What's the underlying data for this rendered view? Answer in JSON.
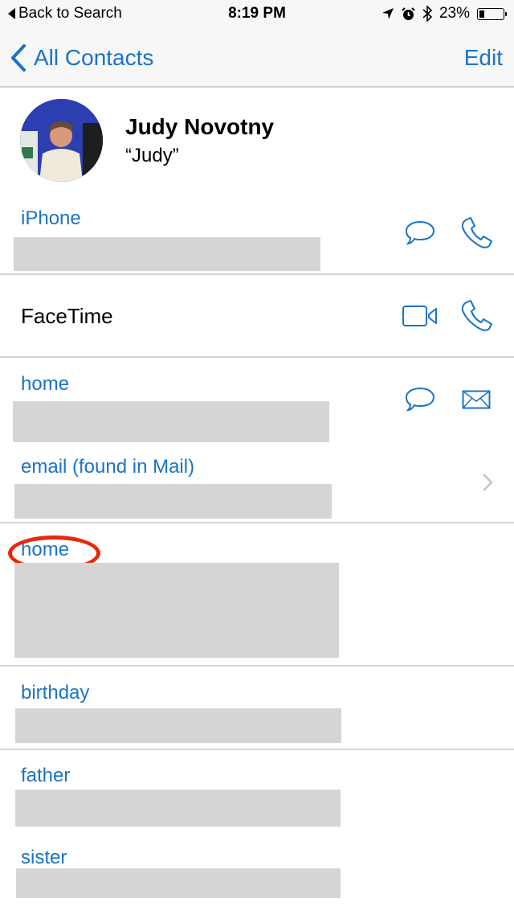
{
  "status_bar": {
    "back_label": "Back to Search",
    "time": "8:19 PM",
    "icons": [
      "location-arrow-icon",
      "alarm-icon",
      "bluetooth-icon"
    ],
    "battery_percent_label": "23%",
    "battery_level": 0.23
  },
  "nav": {
    "back_label": "All Contacts",
    "edit_label": "Edit"
  },
  "contact": {
    "name": "Judy Novotny",
    "nickname": "“Judy”"
  },
  "fields": {
    "iphone": {
      "label": "iPhone",
      "actions": [
        "message-icon",
        "phone-icon"
      ]
    },
    "facetime": {
      "label": "FaceTime",
      "actions": [
        "video-camera-icon",
        "phone-icon"
      ]
    },
    "home_email": {
      "label": "home",
      "actions": [
        "message-icon",
        "mail-icon"
      ]
    },
    "found_email": {
      "label": "email (found in Mail)",
      "action": "chevron-right-icon"
    },
    "home_address": {
      "label": "home"
    },
    "birthday": {
      "label": "birthday"
    },
    "father": {
      "label": "father"
    },
    "sister": {
      "label": "sister"
    }
  },
  "colors": {
    "accent": "#1a73c8",
    "annotation": "#e8280c",
    "redaction": "#d5d5d5"
  }
}
